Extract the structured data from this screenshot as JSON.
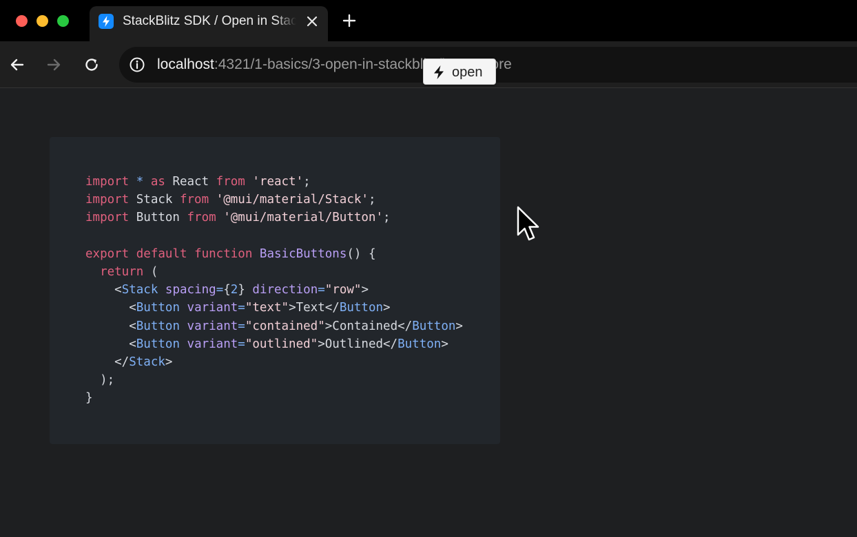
{
  "window": {
    "controls": [
      "close",
      "minimize",
      "maximize"
    ]
  },
  "tab": {
    "title": "StackBlitz SDK / Open in StackBlitz",
    "favicon": "stackblitz-bolt-icon",
    "favicon_color": "#1389fd"
  },
  "toolbar": {
    "url_host": "localhost",
    "url_path": ":4321/1-basics/3-open-in-stackblitz/learn-more"
  },
  "open_button": {
    "label": "open",
    "icon": "bolt-icon"
  },
  "code": {
    "language": "jsx",
    "lines": [
      [
        [
          "kw",
          "import"
        ],
        [
          "op",
          " * "
        ],
        [
          "kw",
          "as"
        ],
        [
          "plain",
          " React "
        ],
        [
          "kw",
          "from"
        ],
        [
          "plain",
          " "
        ],
        [
          "str",
          "'react'"
        ],
        [
          "plain",
          ";"
        ]
      ],
      [
        [
          "kw",
          "import"
        ],
        [
          "plain",
          " Stack "
        ],
        [
          "kw",
          "from"
        ],
        [
          "plain",
          " "
        ],
        [
          "str",
          "'@mui/material/Stack'"
        ],
        [
          "plain",
          ";"
        ]
      ],
      [
        [
          "kw",
          "import"
        ],
        [
          "plain",
          " Button "
        ],
        [
          "kw",
          "from"
        ],
        [
          "plain",
          " "
        ],
        [
          "str",
          "'@mui/material/Button'"
        ],
        [
          "plain",
          ";"
        ]
      ],
      [],
      [
        [
          "kw",
          "export"
        ],
        [
          "plain",
          " "
        ],
        [
          "kw",
          "default"
        ],
        [
          "plain",
          " "
        ],
        [
          "kw",
          "function"
        ],
        [
          "plain",
          " "
        ],
        [
          "fn",
          "BasicButtons"
        ],
        [
          "plain",
          "() {"
        ]
      ],
      [
        [
          "plain",
          "  "
        ],
        [
          "kw",
          "return"
        ],
        [
          "plain",
          " ("
        ]
      ],
      [
        [
          "plain",
          "    <"
        ],
        [
          "tag",
          "Stack"
        ],
        [
          "plain",
          " "
        ],
        [
          "attr",
          "spacing"
        ],
        [
          "op",
          "="
        ],
        [
          "plain",
          "{"
        ],
        [
          "num",
          "2"
        ],
        [
          "plain",
          "} "
        ],
        [
          "attr",
          "direction"
        ],
        [
          "op",
          "="
        ],
        [
          "str",
          "\"row\""
        ],
        [
          "plain",
          ">"
        ]
      ],
      [
        [
          "plain",
          "      <"
        ],
        [
          "tag",
          "Button"
        ],
        [
          "plain",
          " "
        ],
        [
          "attr",
          "variant"
        ],
        [
          "op",
          "="
        ],
        [
          "str",
          "\"text\""
        ],
        [
          "plain",
          ">Text</"
        ],
        [
          "tag",
          "Button"
        ],
        [
          "plain",
          ">"
        ]
      ],
      [
        [
          "plain",
          "      <"
        ],
        [
          "tag",
          "Button"
        ],
        [
          "plain",
          " "
        ],
        [
          "attr",
          "variant"
        ],
        [
          "op",
          "="
        ],
        [
          "str",
          "\"contained\""
        ],
        [
          "plain",
          ">Contained</"
        ],
        [
          "tag",
          "Button"
        ],
        [
          "plain",
          ">"
        ]
      ],
      [
        [
          "plain",
          "      <"
        ],
        [
          "tag",
          "Button"
        ],
        [
          "plain",
          " "
        ],
        [
          "attr",
          "variant"
        ],
        [
          "op",
          "="
        ],
        [
          "str",
          "\"outlined\""
        ],
        [
          "plain",
          ">Outlined</"
        ],
        [
          "tag",
          "Button"
        ],
        [
          "plain",
          ">"
        ]
      ],
      [
        [
          "plain",
          "    </"
        ],
        [
          "tag",
          "Stack"
        ],
        [
          "plain",
          ">"
        ]
      ],
      [
        [
          "plain",
          "  );"
        ]
      ],
      [
        [
          "plain",
          "}"
        ]
      ]
    ]
  }
}
